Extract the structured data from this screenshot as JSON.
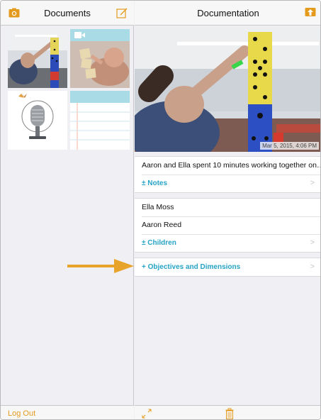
{
  "colors": {
    "accent": "#e49b1d",
    "link": "#25a3c4",
    "arrow": "#e8a42a"
  },
  "left": {
    "title": "Documents",
    "camera_icon": "camera-icon",
    "compose_icon": "compose-icon",
    "logout_label": "Log Out"
  },
  "right": {
    "title": "Documentation",
    "share_icon": "share-icon",
    "photo_date": "Mar 5, 2015, 4:06 PM",
    "note_text": "Aaron and Ella spent 10 minutes working together on…",
    "notes_label": "± Notes",
    "children": [
      "Ella Moss",
      "Aaron Reed"
    ],
    "children_label": "± Children",
    "objectives_label": "+ Objectives and Dimensions",
    "chevron": ">",
    "expand_icon": "expand-icon",
    "trash_icon": "trash-icon"
  }
}
